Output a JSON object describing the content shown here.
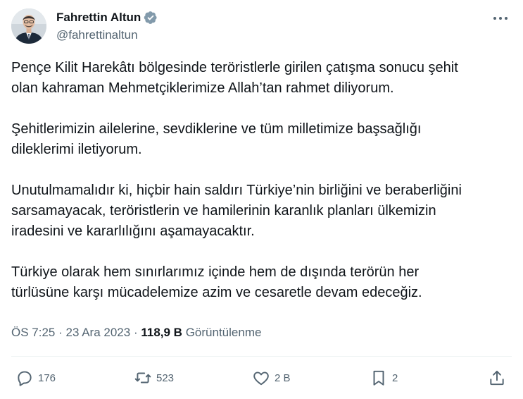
{
  "author": {
    "display_name": "Fahrettin Altun",
    "handle": "@fahrettinaltun",
    "verified_badge": "verified-badge-icon",
    "badge_color": "#829aab"
  },
  "tweet": {
    "paragraphs": [
      "Pençe Kilit Harekâtı bölgesinde teröristlerle girilen çatışma sonucu şehit\nolan kahraman Mehmetçiklerimize Allah’tan rahmet diliyorum.",
      "Şehitlerimizin ailelerine, sevdiklerine ve tüm milletimize başsağlığı\ndileklerimi iletiyorum.",
      "Unutulmamalıdır ki, hiçbir hain saldırı Türkiye’nin birliğini ve beraberliğini\nsarsamayacak, teröristlerin ve hamilerinin karanlık planları ülkemizin\niradesini ve kararlılığını aşamayacaktır.",
      "Türkiye olarak hem sınırlarımız içinde hem de dışında terörün her\ntürlüsüne karşı mücadelemize azim ve cesaretle devam edeceğiz."
    ]
  },
  "meta": {
    "time": "ÖS 7:25",
    "separator": "·",
    "date": "23 Ara 2023",
    "views_count": "118,9 B",
    "views_label": "Görüntülenme"
  },
  "actions": {
    "replies": {
      "icon": "reply-icon",
      "count": "176"
    },
    "reposts": {
      "icon": "repost-icon",
      "count": "523"
    },
    "likes": {
      "icon": "heart-icon",
      "count": "2 B"
    },
    "bookmarks": {
      "icon": "bookmark-icon",
      "count": "2"
    },
    "share": {
      "icon": "share-icon"
    }
  },
  "colors": {
    "text_primary": "#0f1419",
    "text_secondary": "#536471",
    "divider": "#eff3f4"
  }
}
